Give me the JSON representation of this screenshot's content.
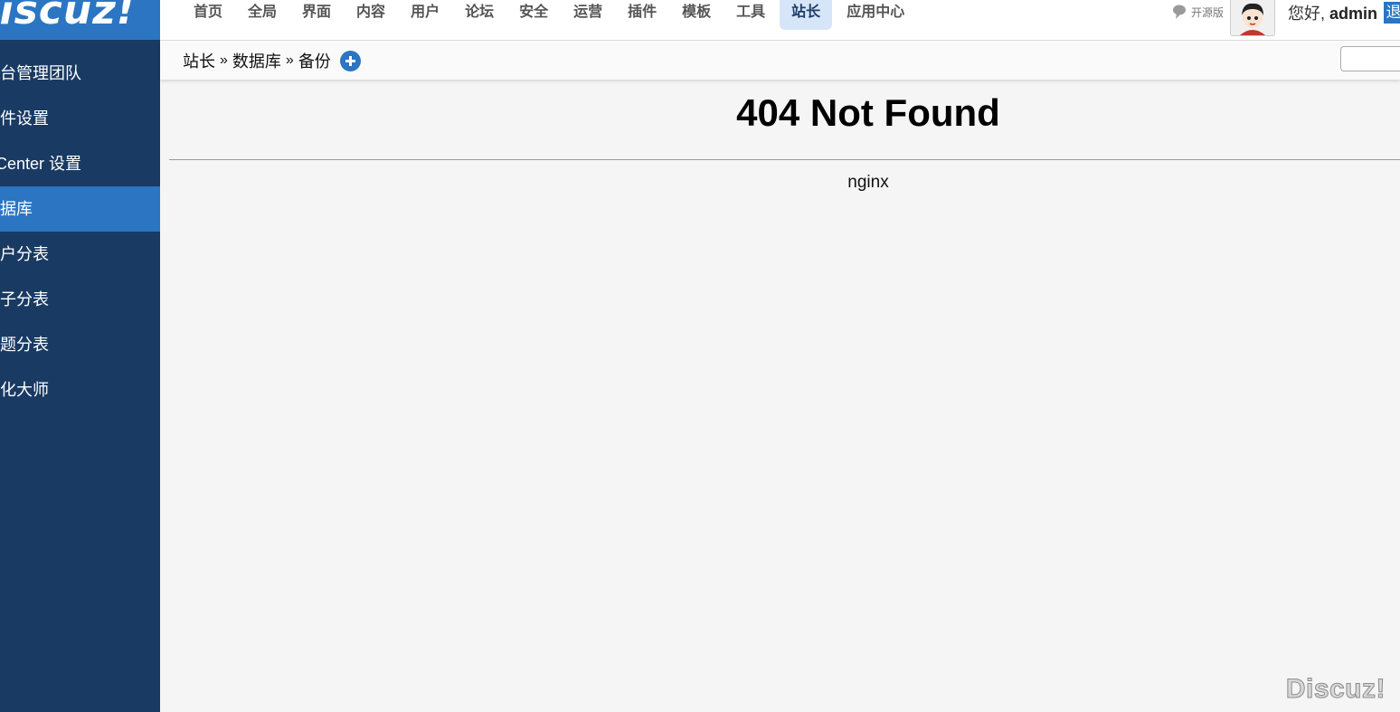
{
  "sidebar": {
    "logo": "Discuz!",
    "items": [
      {
        "label": "后台管理团队",
        "active": false
      },
      {
        "label": "邮件设置",
        "active": false
      },
      {
        "label": "UCenter 设置",
        "active": false
      },
      {
        "label": "数据库",
        "active": true
      },
      {
        "label": "用户分表",
        "active": false
      },
      {
        "label": "帖子分表",
        "active": false
      },
      {
        "label": "主题分表",
        "active": false
      },
      {
        "label": "优化大师",
        "active": false
      }
    ]
  },
  "topnav": {
    "items": [
      {
        "label": "首页",
        "active": false
      },
      {
        "label": "全局",
        "active": false
      },
      {
        "label": "界面",
        "active": false
      },
      {
        "label": "内容",
        "active": false
      },
      {
        "label": "用户",
        "active": false
      },
      {
        "label": "论坛",
        "active": false
      },
      {
        "label": "安全",
        "active": false
      },
      {
        "label": "运营",
        "active": false
      },
      {
        "label": "插件",
        "active": false
      },
      {
        "label": "模板",
        "active": false
      },
      {
        "label": "工具",
        "active": false
      },
      {
        "label": "站长",
        "active": true
      },
      {
        "label": "应用中心",
        "active": false
      }
    ],
    "open_source_label": "开源版",
    "greeting": "您好,",
    "username": "admin",
    "logout_label": "退出"
  },
  "breadcrumb": {
    "items": [
      "站长",
      "数据库",
      "备份"
    ],
    "separator": "»"
  },
  "content": {
    "title": "404 Not Found",
    "server": "nginx"
  },
  "watermark": "Discuz!",
  "colors": {
    "sidebar_bg": "#193a63",
    "accent": "#2b75c3",
    "nav_active_bg": "#d6e6f8"
  }
}
